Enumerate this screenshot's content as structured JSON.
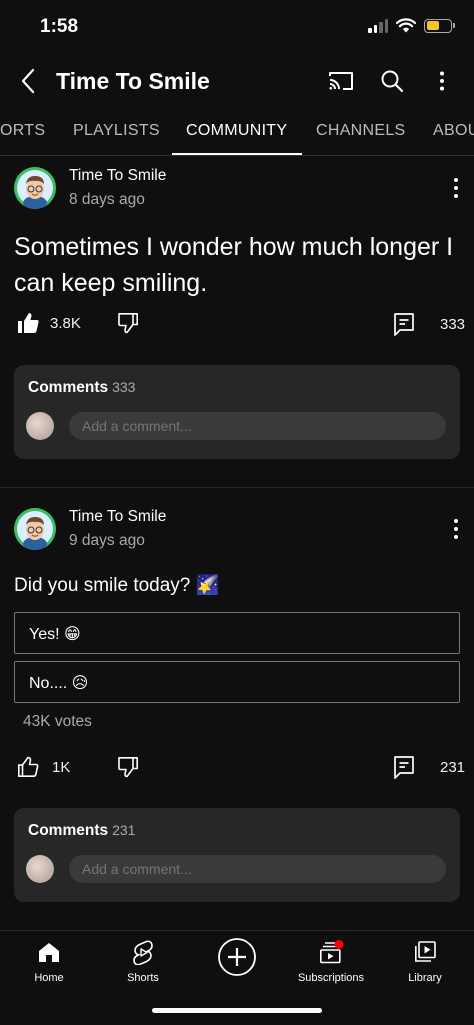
{
  "status_bar": {
    "time": "1:58"
  },
  "header": {
    "title": "Time To Smile"
  },
  "tabs": [
    {
      "label": "ORTS"
    },
    {
      "label": "PLAYLISTS"
    },
    {
      "label": "COMMUNITY"
    },
    {
      "label": "CHANNELS"
    },
    {
      "label": "ABOU"
    }
  ],
  "posts": [
    {
      "author": "Time To Smile",
      "time": "8 days ago",
      "text": "Sometimes I wonder how much longer I can keep smiling.",
      "likes": "3.8K",
      "comments_count": "333",
      "comments_label": "Comments",
      "comments_header_count": "333",
      "comment_placeholder": "Add a comment..."
    },
    {
      "author": "Time To Smile",
      "time": "9 days ago",
      "text": "Did you smile today? 🌠",
      "poll_options": [
        "Yes! 😁",
        "No.... 😥"
      ],
      "votes": "43K votes",
      "likes": "1K",
      "comments_count": "231",
      "comments_label": "Comments",
      "comments_header_count": "231",
      "comment_placeholder": "Add a comment..."
    }
  ],
  "bottom_nav": [
    {
      "label": "Home",
      "icon": "home-icon"
    },
    {
      "label": "Shorts",
      "icon": "shorts-icon"
    },
    {
      "label": "",
      "icon": "create-icon"
    },
    {
      "label": "Subscriptions",
      "icon": "subscriptions-icon"
    },
    {
      "label": "Library",
      "icon": "library-icon"
    }
  ],
  "colors": {
    "background": "#0f0f0f",
    "card": "#272727",
    "notification": "#ff0000",
    "battery": "#f7c325"
  }
}
